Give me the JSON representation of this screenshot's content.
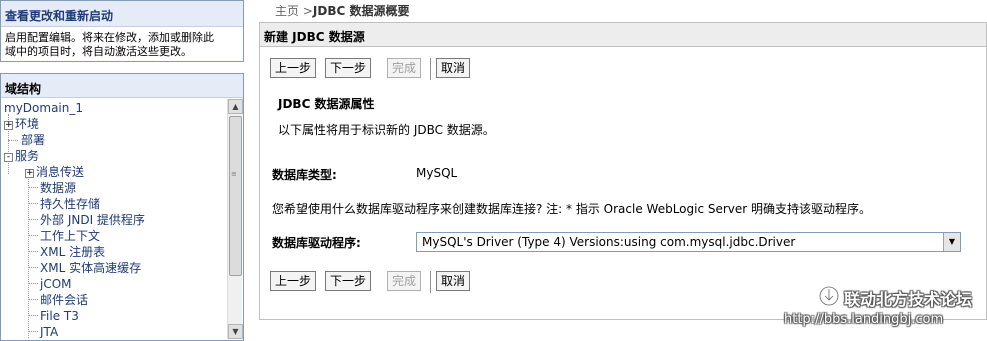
{
  "change_center": {
    "title": "查看更改和重新启动",
    "text_line1": "启用配置编辑。将来在修改，添加或删除此",
    "text_line2": "域中的项目时，将自动激活这些更改。"
  },
  "domain_structure": {
    "title": "域结构",
    "tree": [
      {
        "label": "myDomain_1",
        "expander": ""
      },
      {
        "label": "环境",
        "expander": "+"
      },
      {
        "label": "部署",
        "expander": ""
      },
      {
        "label": "服务",
        "expander": "-"
      },
      {
        "label": "消息传送",
        "expander": "+"
      },
      {
        "label": "数据源",
        "expander": ""
      },
      {
        "label": "持久性存储",
        "expander": ""
      },
      {
        "label": "外部 JNDI 提供程序",
        "expander": ""
      },
      {
        "label": "工作上下文",
        "expander": ""
      },
      {
        "label": "XML 注册表",
        "expander": ""
      },
      {
        "label": "XML 实体高速缓存",
        "expander": ""
      },
      {
        "label": "jCOM",
        "expander": ""
      },
      {
        "label": "邮件会话",
        "expander": ""
      },
      {
        "label": "File T3",
        "expander": ""
      },
      {
        "label": "JTA",
        "expander": ""
      }
    ]
  },
  "breadcrumb": {
    "home": "主页",
    "separator": ">",
    "current": "JDBC 数据源概要"
  },
  "wizard": {
    "title": "新建 JDBC 数据源",
    "buttons": {
      "back": "上一步",
      "next": "下一步",
      "finish": "完成",
      "cancel": "取消"
    },
    "section_title": "JDBC 数据源属性",
    "section_desc": "以下属性将用于标识新的 JDBC 数据源。",
    "db_type_label": "数据库类型:",
    "db_type_value": "MySQL",
    "driver_hint": "您希望使用什么数据库驱动程序来创建数据库连接? 注: * 指示 Oracle WebLogic Server 明确支持该驱动程序。",
    "driver_label": "数据库驱动程序:",
    "driver_selected": "MySQL's Driver (Type 4) Versions:using com.mysql.jdbc.Driver"
  },
  "watermark": {
    "line1": "联动北方技术论坛",
    "line2": "http://bbs.landingbj.com"
  },
  "icons": {
    "select_arrow": "chevron-down-icon",
    "scroll_up": "arrow-up-icon",
    "scroll_down": "arrow-down-icon"
  }
}
